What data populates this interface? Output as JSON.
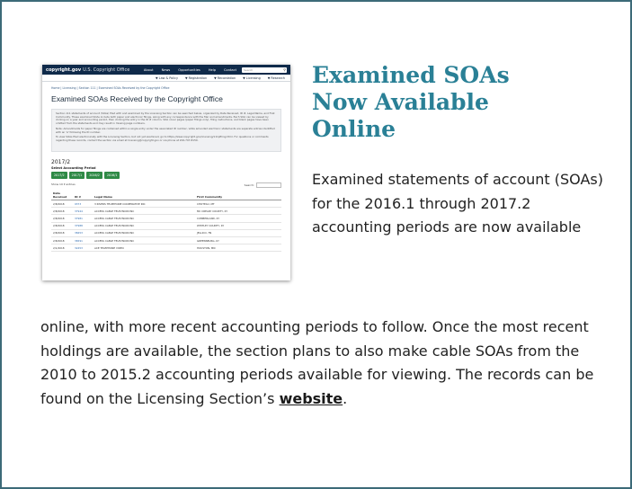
{
  "article": {
    "headline": "Examined SOAs Now Available Online",
    "lead_text": "Examined statements of account (SOAs) for the 2016.1 through 2017.2 accounting periods are now available",
    "body_text": "online, with more recent accounting periods to follow. Once the most recent holdings are available, the section plans to also make cable SOAs from the 2010 to 2015.2 accounting periods available for viewing. The records can be found on the Licensing Section’s ",
    "link_text": "website",
    "body_end": "."
  },
  "screenshot": {
    "brand": "copyright.gov",
    "brand_sub": "U.S. Copyright Office",
    "top_nav": [
      "About",
      "News",
      "Opportunities",
      "Help",
      "Contact"
    ],
    "search_placeholder": "Search",
    "sub_nav": [
      "▼ Law & Policy",
      "▼ Registration",
      "▼ Recordation",
      "▼ Licensing",
      "▼ Research"
    ],
    "breadcrumb": "Home | Licensing | Section 111 | Examined SOAs Received by the Copyright Office",
    "page_title": "Examined SOAs Received by the Copyright Office",
    "info_paragraphs": [
      "Section 111 statements of account (SOAs) filed with and examined by the Licensing Section can be searched below, organized by Date Received, ID #, Legal Name, and First Community. These examined SOAs include both paper and electronic filings, along with any correspondence with the filer and amendments. Each SOA can be viewed by clicking on a year and accounting period, then clicking the entry in the ID # column. SOA cover pages (paper filings only), filing instructions, and blank pages have been omitted from the statements and may result in missing page numbers.",
      "Note: Amendments for paper filings are contained within a single entry under the associated ID number, while amended electronic statements are separate entries identified with an 'A' following the ID number.",
      "To view SOAs filed electronically with the Licensing Section, but not yet examined, go to https://www.copyright.gov/licensing/111pfiling.html. For questions or comments regarding these records, contact the section via email at licensing@copyright.gov or via phone at 202-707-8150."
    ],
    "period_heading": "2017/2",
    "select_label": "Select Accounting Period",
    "period_buttons": [
      "2017/2",
      "2017/1",
      "2016/2",
      "2016/1"
    ],
    "show_entries": "Show  10  ▾  entries",
    "search_label": "Search:",
    "table_headers": [
      "Date Received",
      "ID #",
      "Legal Name",
      "First Community"
    ],
    "table_rows": [
      [
        "2/8/2018",
        "9373",
        "3 RIVERS TELEPHONE COOPERATIVE INC",
        "CHOTEAU, MT"
      ],
      [
        "2/8/2018",
        "37944",
        "ACCESS CABLE TELEVISION INC",
        "MC CREARY COUNTY, KY"
      ],
      [
        "2/8/2018",
        "37981",
        "ACCESS CABLE TELEVISION INC",
        "CUMBERLAND, KY"
      ],
      [
        "2/8/2018",
        "37988",
        "ACCESS CABLE TELEVISION INC",
        "WHITLEY COUNTY, KY"
      ],
      [
        "2/8/2018",
        "38453",
        "ACCESS CABLE TELEVISION INC",
        "JELLICO, TN"
      ],
      [
        "2/8/2018",
        "36591",
        "ACCESS CABLE TELEVISION INC",
        "GREENSBURG, KY"
      ],
      [
        "2/1/2018",
        "32453",
        "ACE TELEPHONE VIDEO",
        "HOUSTON, MN"
      ]
    ]
  }
}
